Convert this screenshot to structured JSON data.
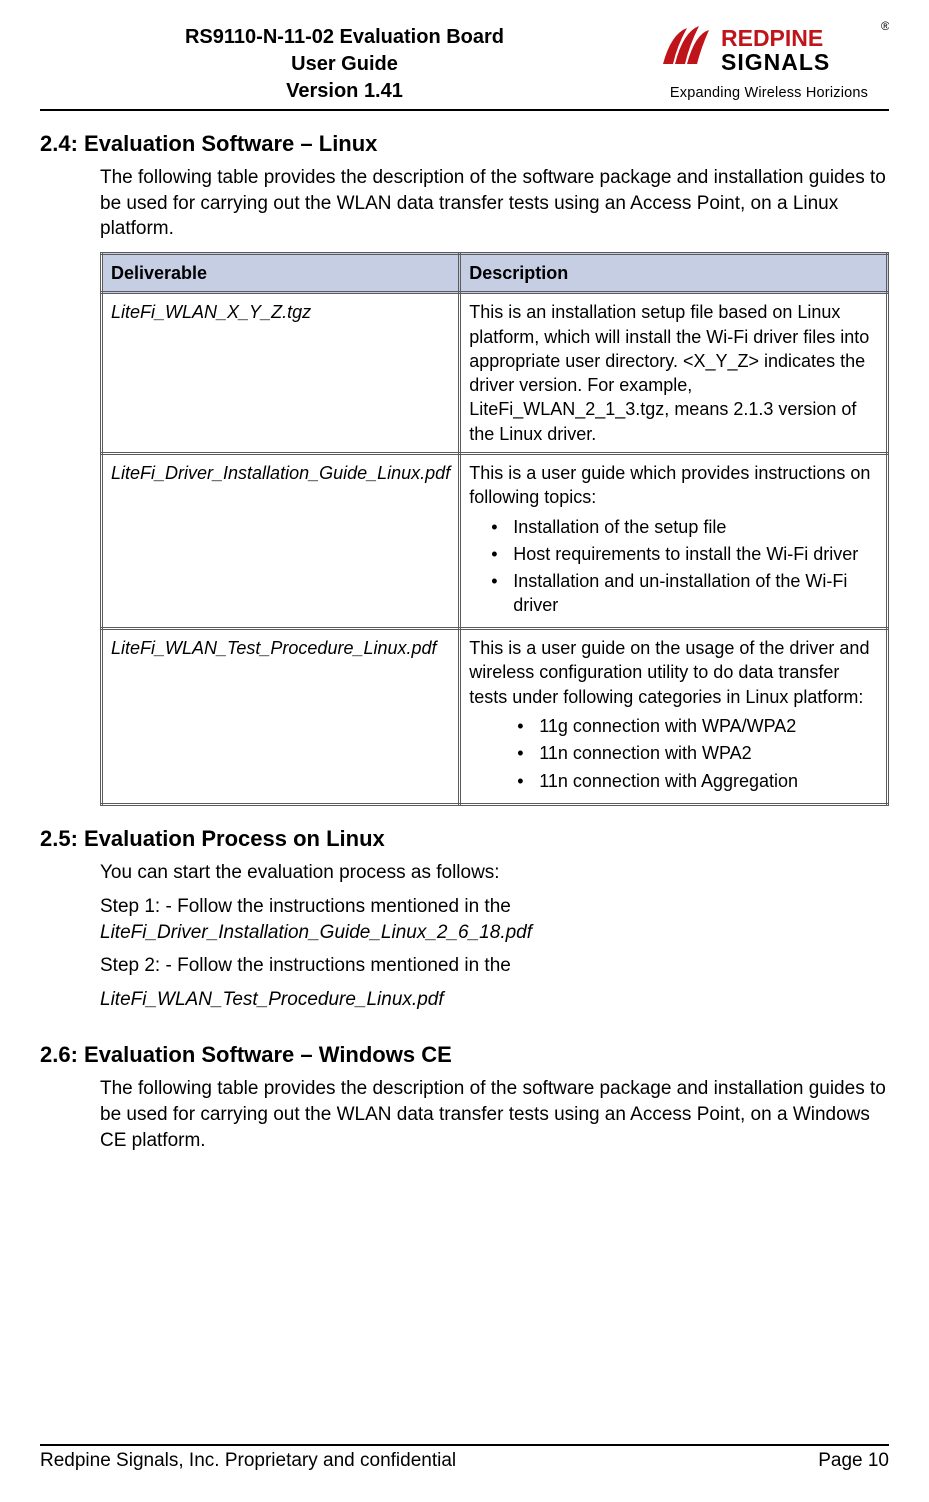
{
  "header": {
    "title_line1": "RS9110-N-11-02 Evaluation Board",
    "title_line2": "User Guide",
    "title_line3": "Version 1.41",
    "logo_brand_top": "REDPINE",
    "logo_brand_bottom": "SIGNALS",
    "logo_tagline": "Expanding Wireless Horizions",
    "reg_mark": "®"
  },
  "sections": {
    "s24": {
      "heading": "2.4: Evaluation Software – Linux",
      "intro": "The following table provides the description of the software package and installation guides to be used for carrying out the WLAN data transfer tests using an Access Point, on a Linux platform.",
      "th1": "Deliverable",
      "th2": "Description",
      "rows": [
        {
          "name": "LiteFi_WLAN_X_Y_Z.tgz",
          "desc": "This is an installation setup file based on Linux platform, which will install the Wi-Fi driver files into appropriate user directory.  <X_Y_Z> indicates the driver version. For example, LiteFi_WLAN_2_1_3.tgz, means 2.1.3 version of the Linux driver."
        },
        {
          "name": "LiteFi_Driver_Installation_Guide_Linux.pdf",
          "desc_lead": "This is a user guide which provides instructions on following topics:",
          "bullets": [
            "Installation of the setup file",
            "Host requirements to install the Wi-Fi driver",
            "Installation and un-installation of the Wi-Fi driver"
          ]
        },
        {
          "name": "LiteFi_WLAN_Test_Procedure_Linux.pdf",
          "desc_lead": "This is a user guide on the usage of the driver and wireless configuration utility to do data transfer tests under following categories in Linux platform:",
          "bullets": [
            "11g connection with WPA/WPA2",
            "11n connection with WPA2",
            "11n connection with Aggregation"
          ]
        }
      ]
    },
    "s25": {
      "heading": "2.5: Evaluation Process on Linux",
      "p1": "You can start the evaluation process as follows:",
      "p2a": "Step 1: - Follow the instructions mentioned in the ",
      "p2b": "LiteFi_Driver_Installation_Guide_Linux_2_6_18.pdf",
      "p3": "Step 2: - Follow the instructions mentioned in the",
      "p4": "LiteFi_WLAN_Test_Procedure_Linux.pdf"
    },
    "s26": {
      "heading": "2.6: Evaluation Software – Windows CE",
      "intro": "The following table provides the description of the software package and installation guides to be used for carrying out the WLAN data transfer tests using an Access Point, on a Windows CE platform."
    }
  },
  "footer": {
    "left": "Redpine Signals, Inc. Proprietary and confidential",
    "right": "Page 10"
  }
}
